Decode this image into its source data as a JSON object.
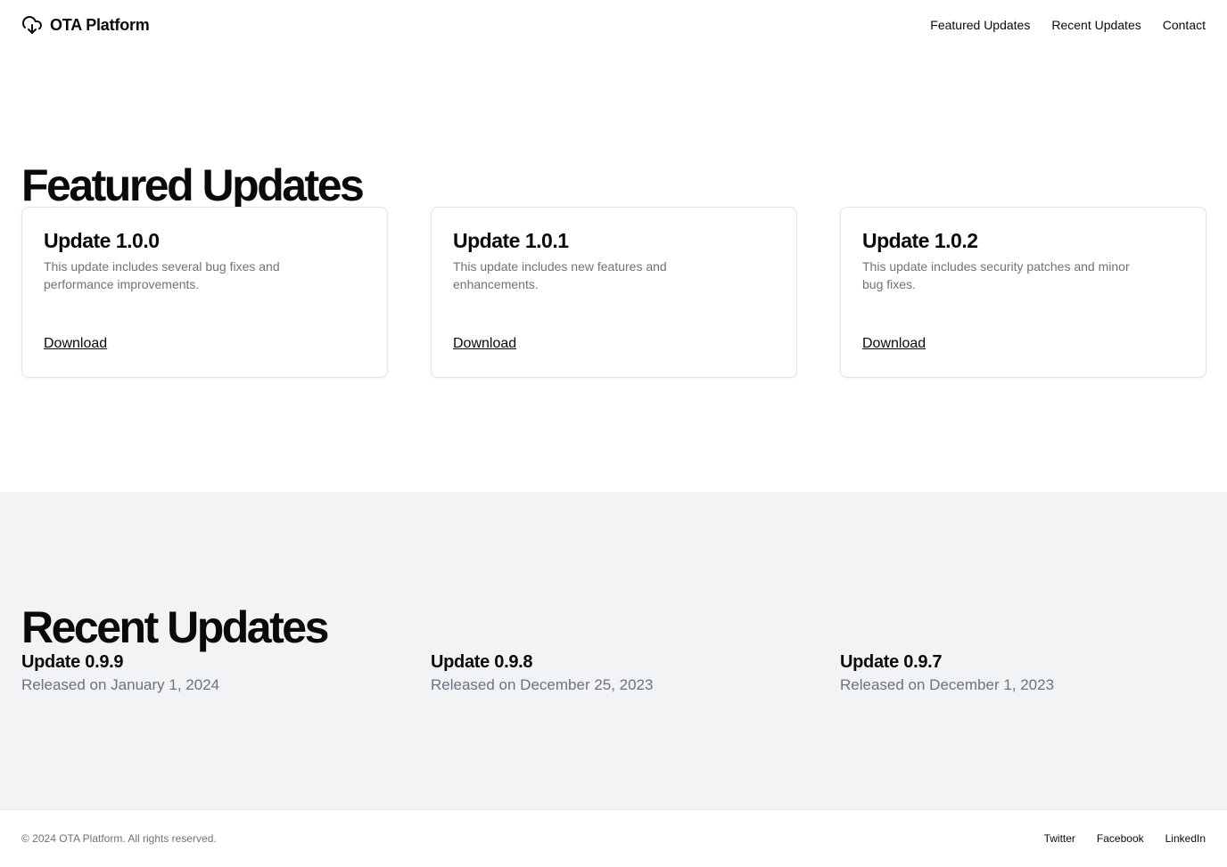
{
  "header": {
    "brand": "OTA Platform",
    "brand_icon": "cloud-download-icon",
    "nav": [
      "Featured Updates",
      "Recent Updates",
      "Contact"
    ]
  },
  "featured": {
    "title": "Featured Updates",
    "cards": [
      {
        "title": "Update 1.0.0",
        "description": "This update includes several bug fixes and performance improvements.",
        "link": "Download"
      },
      {
        "title": "Update 1.0.1",
        "description": "This update includes new features and enhancements.",
        "link": "Download"
      },
      {
        "title": "Update 1.0.2",
        "description": "This update includes security patches and minor bug fixes.",
        "link": "Download"
      }
    ]
  },
  "recent": {
    "title": "Recent Updates",
    "items": [
      {
        "title": "Update 0.9.9",
        "date": "Released on January 1, 2024"
      },
      {
        "title": "Update 0.9.8",
        "date": "Released on December 25, 2023"
      },
      {
        "title": "Update 0.9.7",
        "date": "Released on December 1, 2023"
      }
    ]
  },
  "footer": {
    "copyright": "© 2024 OTA Platform. All rights reserved.",
    "links": [
      "Twitter",
      "Facebook",
      "LinkedIn"
    ]
  },
  "colors": {
    "text": "#0a0a0a",
    "muted": "#71717a",
    "recent_background": "#f2f3f5",
    "card_border": "#e4e4e7"
  }
}
